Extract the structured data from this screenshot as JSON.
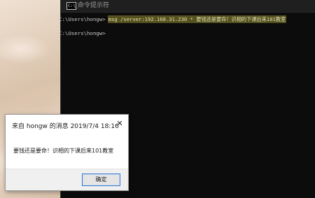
{
  "cmd_window": {
    "icon_glyph": "C:\\_",
    "title": "命令提示符",
    "lines": [
      {
        "prompt": "C:\\Users\\hongw>",
        "command": "msg /server:192.168.31.230 * 要钱还是要命！识相的下课后来101教室"
      },
      {
        "prompt": "C:\\Users\\hongw>",
        "command": ""
      }
    ]
  },
  "message_box": {
    "title": "来自 hongw 的消息 2019/7/4 18:16",
    "close_glyph": "✕",
    "message": "要钱还是要命！识相的下课后来101教室",
    "ok_label": "确定"
  },
  "colors": {
    "console_bg": "#0c0c0c",
    "console_text": "#c8c8c8",
    "selection_highlight": "#55521f",
    "dialog_button_border": "#3a78c9"
  }
}
